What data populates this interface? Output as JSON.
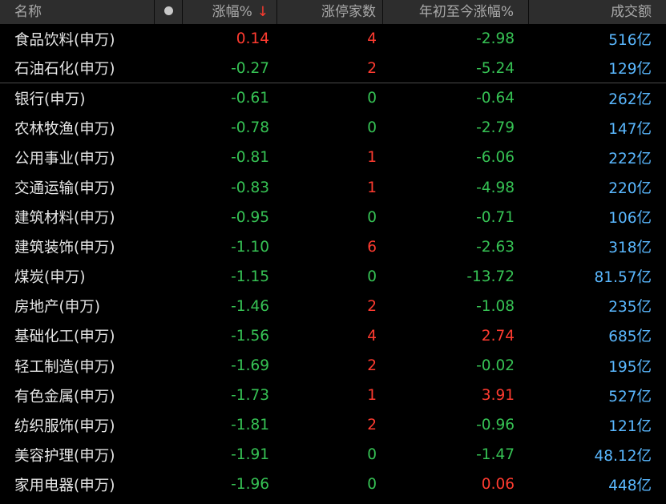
{
  "headers": {
    "name": "名称",
    "change": "涨幅%",
    "change_sort_icon": "arrow-down-icon",
    "limit_up": "涨停家数",
    "ytd": "年初至今涨幅%",
    "volume": "成交额"
  },
  "colors": {
    "up": "#ff3b30",
    "down": "#36c254",
    "volume": "#5ab8ff"
  },
  "rows": [
    {
      "name": "食品饮料(申万)",
      "change": "0.14",
      "limit_up": "4",
      "ytd": "-2.98",
      "volume": "516亿"
    },
    {
      "name": "石油石化(申万)",
      "change": "-0.27",
      "limit_up": "2",
      "ytd": "-5.24",
      "volume": "129亿"
    },
    {
      "name": "银行(申万)",
      "change": "-0.61",
      "limit_up": "0",
      "ytd": "-0.64",
      "volume": "262亿"
    },
    {
      "name": "农林牧渔(申万)",
      "change": "-0.78",
      "limit_up": "0",
      "ytd": "-2.79",
      "volume": "147亿"
    },
    {
      "name": "公用事业(申万)",
      "change": "-0.81",
      "limit_up": "1",
      "ytd": "-6.06",
      "volume": "222亿"
    },
    {
      "name": "交通运输(申万)",
      "change": "-0.83",
      "limit_up": "1",
      "ytd": "-4.98",
      "volume": "220亿"
    },
    {
      "name": "建筑材料(申万)",
      "change": "-0.95",
      "limit_up": "0",
      "ytd": "-0.71",
      "volume": "106亿"
    },
    {
      "name": "建筑装饰(申万)",
      "change": "-1.10",
      "limit_up": "6",
      "ytd": "-2.63",
      "volume": "318亿"
    },
    {
      "name": "煤炭(申万)",
      "change": "-1.15",
      "limit_up": "0",
      "ytd": "-13.72",
      "volume": "81.57亿"
    },
    {
      "name": "房地产(申万)",
      "change": "-1.46",
      "limit_up": "2",
      "ytd": "-1.08",
      "volume": "235亿"
    },
    {
      "name": "基础化工(申万)",
      "change": "-1.56",
      "limit_up": "4",
      "ytd": "2.74",
      "volume": "685亿"
    },
    {
      "name": "轻工制造(申万)",
      "change": "-1.69",
      "limit_up": "2",
      "ytd": "-0.02",
      "volume": "195亿"
    },
    {
      "name": "有色金属(申万)",
      "change": "-1.73",
      "limit_up": "1",
      "ytd": "3.91",
      "volume": "527亿"
    },
    {
      "name": "纺织服饰(申万)",
      "change": "-1.81",
      "limit_up": "2",
      "ytd": "-0.96",
      "volume": "121亿"
    },
    {
      "name": "美容护理(申万)",
      "change": "-1.91",
      "limit_up": "0",
      "ytd": "-1.47",
      "volume": "48.12亿"
    },
    {
      "name": "家用电器(申万)",
      "change": "-1.96",
      "limit_up": "0",
      "ytd": "0.06",
      "volume": "448亿"
    }
  ]
}
